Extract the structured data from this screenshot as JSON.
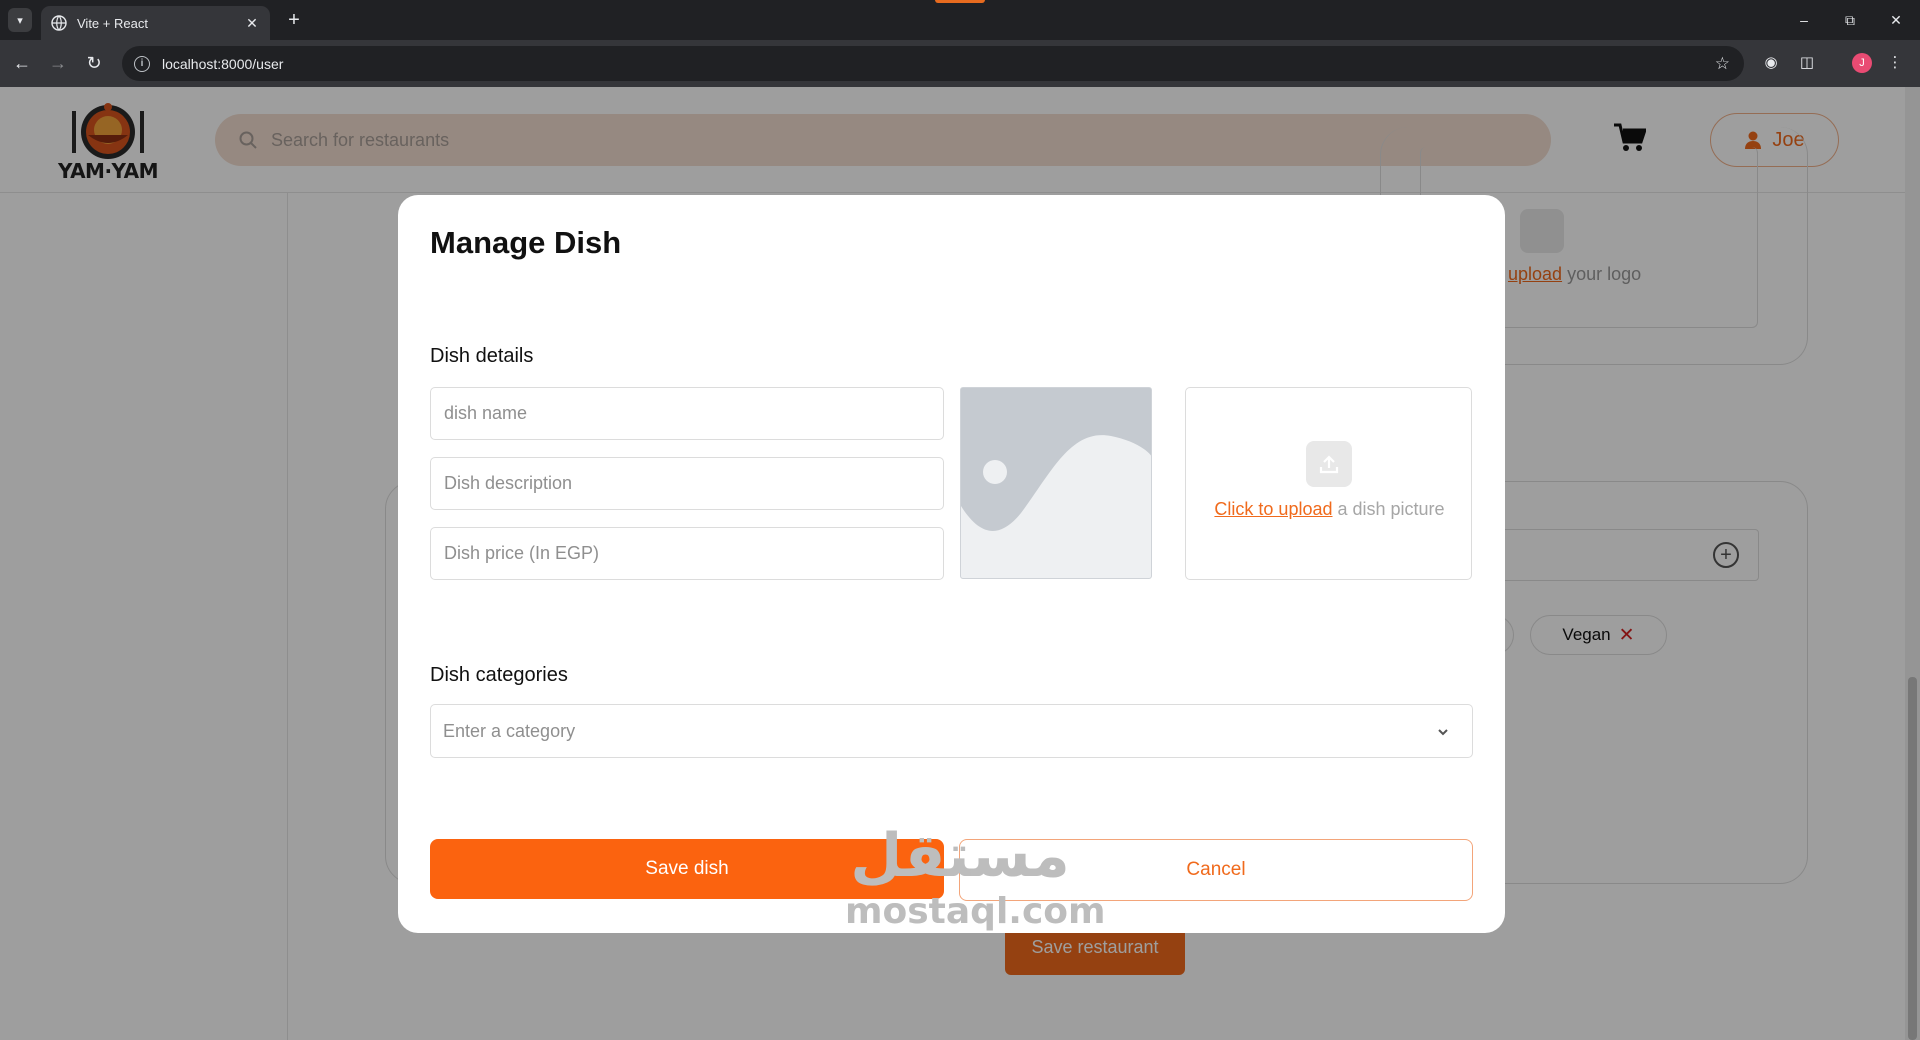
{
  "browser": {
    "tab_title": "Vite + React",
    "url": "localhost:8000/user",
    "profile_initial": "J"
  },
  "header": {
    "logo_text": "YAM·YAM",
    "search_placeholder": "Search for restaurants",
    "user_name": "Joe"
  },
  "background": {
    "logo_upload_link": "upload",
    "logo_upload_rest": " your logo",
    "chip_label": "Vegan",
    "save_restaurant_label": "Save restaurant",
    "watermark_ar": "مستقل",
    "watermark_en": "mostaql.com"
  },
  "modal": {
    "title": "Manage Dish",
    "dish_details_label": "Dish details",
    "dish_name_placeholder": "dish name",
    "dish_description_placeholder": "Dish description",
    "dish_price_placeholder": "Dish price (In EGP)",
    "upload_link": "Click to upload",
    "upload_rest": " a dish picture",
    "categories_label": "Dish categories",
    "category_placeholder": "Enter a category",
    "save_label": "Save dish",
    "cancel_label": "Cancel"
  },
  "colors": {
    "accent": "#fb630f",
    "link": "#f06a1c",
    "search_bg": "#f3ddd0",
    "danger": "#d61f1f"
  }
}
